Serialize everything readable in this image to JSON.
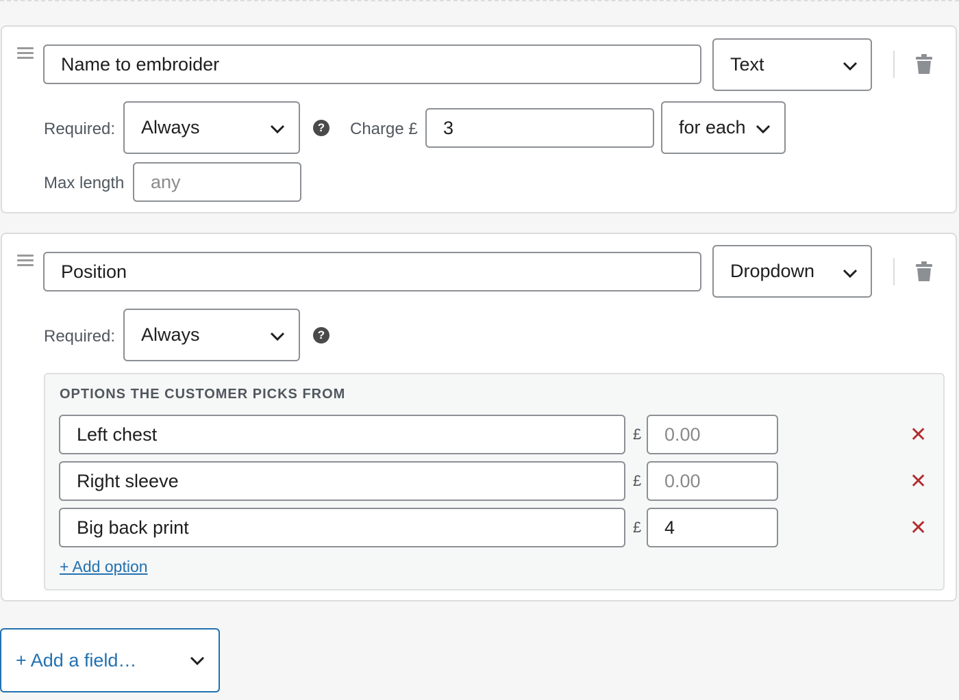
{
  "fields": [
    {
      "name_value": "Name to embroider",
      "type_value": "Text",
      "required_label": "Required:",
      "required_value": "Always",
      "help_glyph": "?",
      "charge_label": "Charge £",
      "charge_value": "3",
      "charge_mode": "for each",
      "maxlen_label": "Max length",
      "maxlen_placeholder": "any"
    },
    {
      "name_value": "Position",
      "type_value": "Dropdown",
      "required_label": "Required:",
      "required_value": "Always",
      "help_glyph": "?",
      "options_title": "OPTIONS THE CUSTOMER PICKS FROM",
      "options": [
        {
          "label": "Left chest",
          "currency": "£",
          "price_value": "",
          "price_placeholder": "0.00"
        },
        {
          "label": "Right sleeve",
          "currency": "£",
          "price_value": "",
          "price_placeholder": "0.00"
        },
        {
          "label": "Big back print",
          "currency": "£",
          "price_value": "4",
          "price_placeholder": ""
        }
      ],
      "remove_glyph": "✕",
      "add_option_label": "+ Add option"
    }
  ],
  "add_field_label": "+ Add a field…",
  "colors": {
    "accent": "#2271b1",
    "danger": "#b32d2e",
    "border": "#8c8f94"
  },
  "icons": [
    "drag-handle-icon",
    "chevron-down-icon",
    "help-icon",
    "trash-icon",
    "remove-icon"
  ]
}
